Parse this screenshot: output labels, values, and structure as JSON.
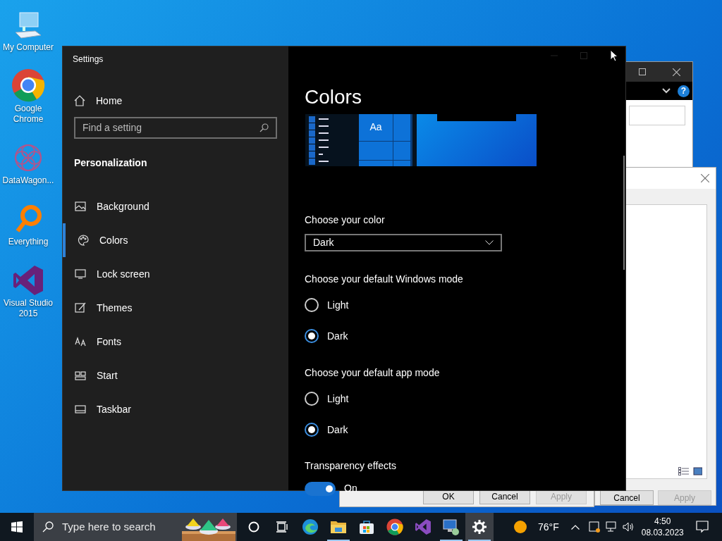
{
  "desktop_icons": [
    {
      "label": "My Computer"
    },
    {
      "label": "Google Chrome"
    },
    {
      "label": "DataWagon..."
    },
    {
      "label": "Everything"
    },
    {
      "label": "Visual Studio 2015"
    }
  ],
  "back_windows": {
    "help": "?",
    "dialog_buttons": [
      {
        "label": "Cancel",
        "disabled": false
      },
      {
        "label": "Apply",
        "disabled": true
      }
    ],
    "lower_buttons": [
      {
        "label": "OK",
        "disabled": false
      },
      {
        "label": "Cancel",
        "disabled": false
      },
      {
        "label": "Apply",
        "disabled": true
      }
    ]
  },
  "settings": {
    "title": "Settings",
    "home": "Home",
    "search": {
      "placeholder": "Find a setting"
    },
    "section": "Personalization",
    "nav": [
      {
        "label": "Background",
        "selected": false
      },
      {
        "label": "Colors",
        "selected": true
      },
      {
        "label": "Lock screen",
        "selected": false
      },
      {
        "label": "Themes",
        "selected": false
      },
      {
        "label": "Fonts",
        "selected": false
      },
      {
        "label": "Start",
        "selected": false
      },
      {
        "label": "Taskbar",
        "selected": false
      }
    ],
    "heading": "Colors",
    "preview_text": "Aa",
    "color_select": {
      "label": "Choose your color",
      "value": "Dark"
    },
    "modes": [
      {
        "label": "Choose your default Windows mode",
        "options": [
          {
            "label": "Light",
            "selected": false
          },
          {
            "label": "Dark",
            "selected": true
          }
        ]
      },
      {
        "label": "Choose your default app mode",
        "options": [
          {
            "label": "Light",
            "selected": false
          },
          {
            "label": "Dark",
            "selected": true
          }
        ]
      }
    ],
    "transparency": {
      "label": "Transparency effects",
      "on": true,
      "state": "On"
    }
  },
  "taskbar": {
    "search": {
      "placeholder": "Type here to search"
    },
    "apps": [
      {
        "selected": false,
        "running": false
      },
      {
        "selected": false,
        "running": false
      },
      {
        "selected": false,
        "running": false
      },
      {
        "selected": false,
        "running": true
      },
      {
        "selected": false,
        "running": false
      },
      {
        "selected": false,
        "running": false
      },
      {
        "selected": false,
        "running": false
      },
      {
        "selected": false,
        "running": true
      },
      {
        "selected": true,
        "running": true
      }
    ],
    "temperature": "76°F",
    "time": "4:50",
    "date": "08.03.2023"
  }
}
